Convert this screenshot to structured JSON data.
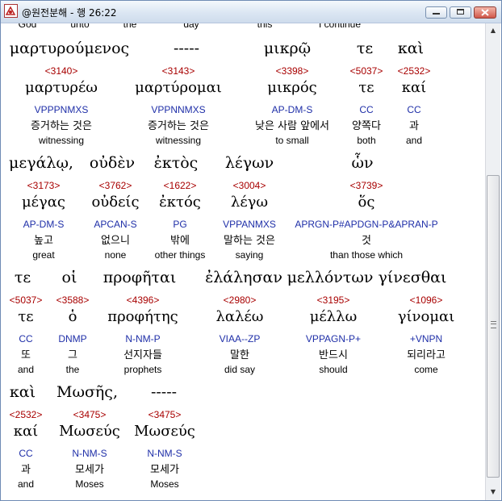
{
  "window": {
    "title": "@원전분해 - 행 26:22"
  },
  "top_partial": [
    "God",
    "unto",
    "the",
    "day",
    "this",
    "I continue"
  ],
  "rows": [
    {
      "words": [
        {
          "greek": "μαρτυρούμενος",
          "strong": "<3140>",
          "lemma": "μαρτυρέω",
          "parse": "VPPPNMXS",
          "korean": "증거하는 것은",
          "english": "witnessing"
        },
        {
          "greek": "-----",
          "strong": "<3143>",
          "lemma": "μαρτύρομαι",
          "parse": "VPPNNMXS",
          "korean": "증거하는 것은",
          "english": "witnessing"
        },
        {
          "greek": "μικρῷ",
          "strong": "<3398>",
          "lemma": "μικρός",
          "parse": "AP-DM-S",
          "korean": "낮은 사람 앞에서",
          "english": "to small"
        },
        {
          "greek": "τε",
          "strong": "<5037>",
          "lemma": "τε",
          "parse": "CC",
          "korean": "양쪽다",
          "english": "both"
        },
        {
          "greek": "καὶ",
          "strong": "<2532>",
          "lemma": "καί",
          "parse": "CC",
          "korean": "과",
          "english": "and"
        }
      ]
    },
    {
      "words": [
        {
          "greek": "μεγάλῳ,",
          "strong": "<3173>",
          "lemma": "μέγας",
          "parse": "AP-DM-S",
          "korean": "높고",
          "english": "great"
        },
        {
          "greek": "οὐδὲν",
          "strong": "<3762>",
          "lemma": "οὐδείς",
          "parse": "APCAN-S",
          "korean": "없으니",
          "english": "none"
        },
        {
          "greek": "ἐκτὸς",
          "strong": "<1622>",
          "lemma": "ἐκτός",
          "parse": "PG",
          "korean": "밖에",
          "english": "other things"
        },
        {
          "greek": "λέγων",
          "strong": "<3004>",
          "lemma": "λέγω",
          "parse": "VPPANMXS",
          "korean": "말하는 것은",
          "english": "saying"
        },
        {
          "greek": "ὧν",
          "strong": "<3739>",
          "lemma": "ὅς",
          "parse": "APRGN-P#APDGN-P&APRAN-P",
          "korean": "것",
          "english": "than those which"
        }
      ]
    },
    {
      "words": [
        {
          "greek": "τε",
          "strong": "<5037>",
          "lemma": "τε",
          "parse": "CC",
          "korean": "또",
          "english": "and"
        },
        {
          "greek": "οἱ",
          "strong": "<3588>",
          "lemma": "ὁ",
          "parse": "DNMP",
          "korean": "그",
          "english": "the"
        },
        {
          "greek": "προφῆται",
          "strong": "<4396>",
          "lemma": "προφήτης",
          "parse": "N-NM-P",
          "korean": "선지자들",
          "english": "prophets"
        },
        {
          "greek": "ἐλάλησαν",
          "strong": "<2980>",
          "lemma": "λαλέω",
          "parse": "VIAA--ZP",
          "korean": "말한",
          "english": "did say"
        },
        {
          "greek": "μελλόντων",
          "strong": "<3195>",
          "lemma": "μέλλω",
          "parse": "VPPAGN-P+",
          "korean": "반드시",
          "english": "should"
        },
        {
          "greek": "γίνεσθαι",
          "strong": "<1096>",
          "lemma": "γίνομαι",
          "parse": "+VNPN",
          "korean": "되리라고",
          "english": "come"
        }
      ]
    },
    {
      "words": [
        {
          "greek": "καὶ",
          "strong": "<2532>",
          "lemma": "καί",
          "parse": "CC",
          "korean": "과",
          "english": "and"
        },
        {
          "greek": "Μωσῆς,",
          "strong": "<3475>",
          "lemma": "Μωσεύς",
          "parse": "N-NM-S",
          "korean": "모세가",
          "english": "Moses"
        },
        {
          "greek": "-----",
          "strong": "<3475>",
          "lemma": "Μωσεύς",
          "parse": "N-NM-S",
          "korean": "모세가",
          "english": "Moses"
        }
      ]
    }
  ]
}
